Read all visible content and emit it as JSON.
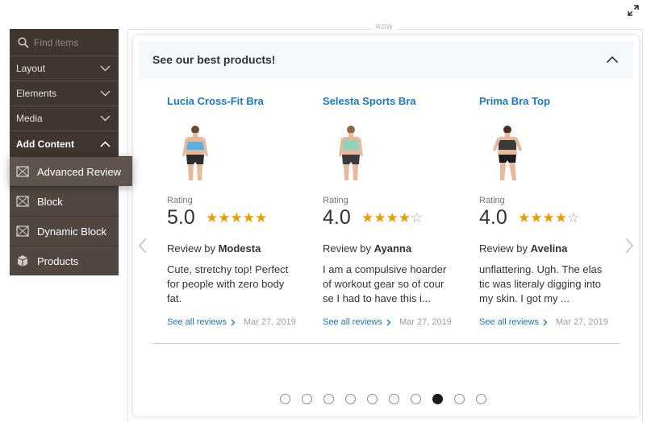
{
  "search": {
    "placeholder": "Find items"
  },
  "categories": [
    {
      "label": "Layout",
      "expanded": false
    },
    {
      "label": "Elements",
      "expanded": false
    },
    {
      "label": "Media",
      "expanded": false
    },
    {
      "label": "Add Content",
      "expanded": true
    }
  ],
  "content_items": [
    {
      "label": "Advanced Review",
      "icon": "widget-icon"
    },
    {
      "label": "Block",
      "icon": "widget-icon"
    },
    {
      "label": "Dynamic Block",
      "icon": "widget-icon"
    },
    {
      "label": "Products",
      "icon": "cube-icon"
    }
  ],
  "stage": {
    "row_label": "ROW"
  },
  "widget": {
    "title": "See our best products!"
  },
  "products": [
    {
      "name": "Lucia Cross-Fit Bra",
      "rating_label": "Rating",
      "score": "5.0",
      "rating": 5,
      "review_by_prefix": "Review by",
      "reviewer": "Modesta",
      "text": "Cute, stretchy top! Perfect for people with zero body fat.",
      "see_all": "See all reviews",
      "date": "Mar 27, 2019",
      "top_color": "#5ab1e0"
    },
    {
      "name": "Selesta Sports Bra",
      "rating_label": "Rating",
      "score": "4.0",
      "rating": 4,
      "review_by_prefix": "Review by",
      "reviewer": "Ayanna",
      "text": "I am a compulsive hoarder of workout gear so of cour se I had to have this i...",
      "see_all": "See all reviews",
      "date": "Mar 27, 2019",
      "top_color": "#8ed3b8"
    },
    {
      "name": "Prima Bra Top",
      "rating_label": "Rating",
      "score": "4.0",
      "rating": 4,
      "review_by_prefix": "Review by",
      "reviewer": "Avelina",
      "text": "unflattering. Ugh. The elas tic was literaly digging into my skin. I got my ...",
      "see_all": "See all reviews",
      "date": "Mar 27, 2019",
      "top_color": "#3a3a3a"
    }
  ],
  "pagination": {
    "total": 10,
    "active": 8
  },
  "colors": {
    "panel": "#41362f",
    "link": "#1979c3",
    "star": "#eb9a00"
  }
}
